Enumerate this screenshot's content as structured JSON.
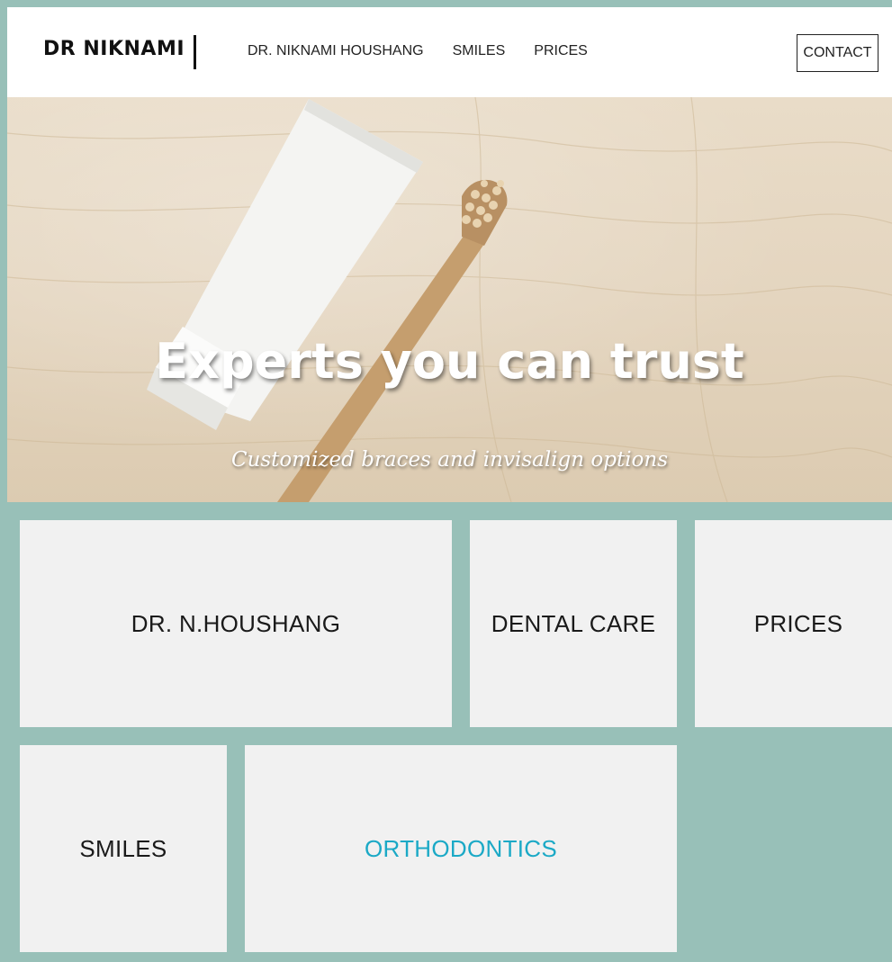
{
  "header": {
    "logo": "DR NIKNAMI",
    "nav": [
      {
        "label": "DR. NIKNAMI HOUSHANG"
      },
      {
        "label": "SMILES"
      },
      {
        "label": "PRICES"
      }
    ],
    "contact_label": "CONTACT"
  },
  "hero": {
    "title": "Experts you can trust",
    "subtitle": "Customized braces and invisalign options"
  },
  "tiles": [
    {
      "label": "DR. N.HOUSHANG"
    },
    {
      "label": "DENTAL CARE"
    },
    {
      "label": "PRICES"
    },
    {
      "label": "SMILES"
    },
    {
      "label": "ORTHODONTICS"
    }
  ],
  "colors": {
    "background": "#98c0b8",
    "tile": "#f1f1f1",
    "accent": "#1ba9c6"
  }
}
